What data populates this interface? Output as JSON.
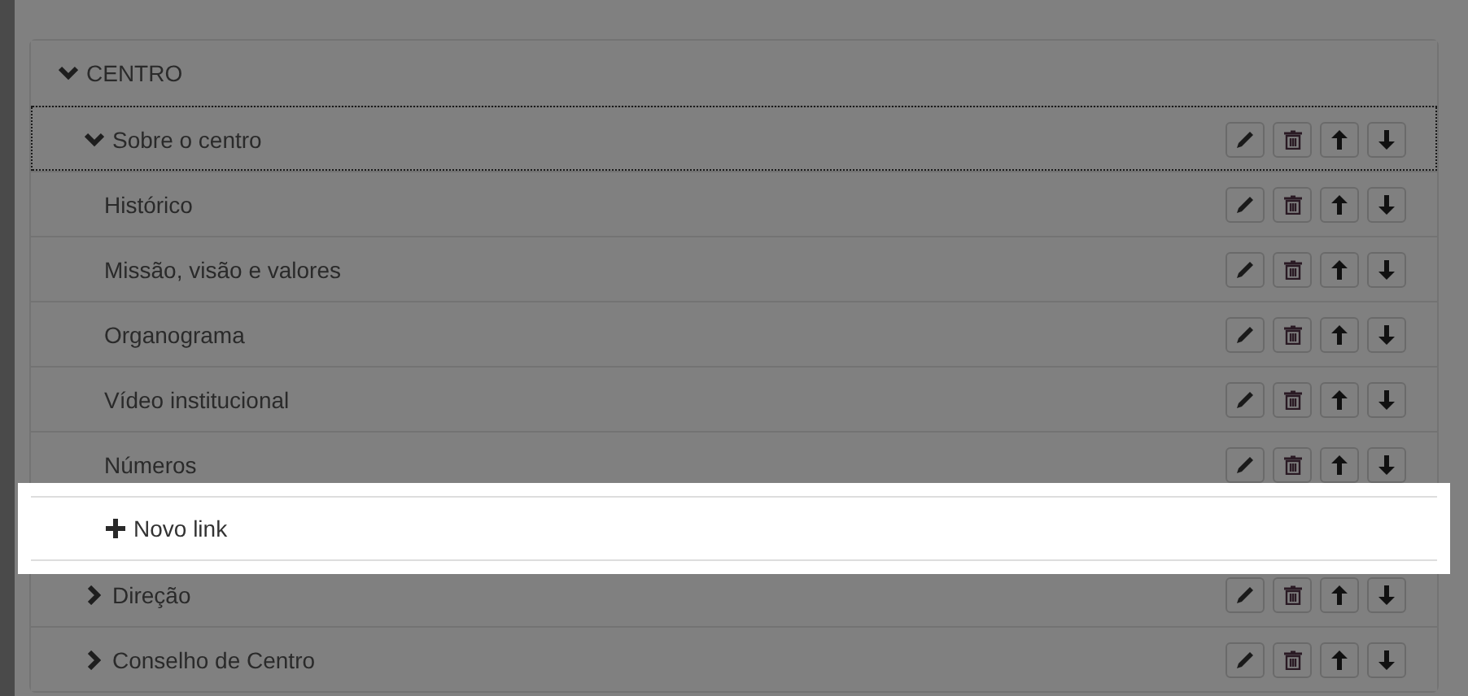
{
  "menu": {
    "label": "CENTRO",
    "expanded": true,
    "items": [
      {
        "label": "Sobre o centro",
        "expanded": true,
        "focused": true,
        "children": [
          {
            "label": "Histórico"
          },
          {
            "label": "Missão, visão e valores"
          },
          {
            "label": "Organograma"
          },
          {
            "label": "Vídeo institucional"
          },
          {
            "label": "Números"
          }
        ],
        "add_link": {
          "label": "Novo link",
          "highlighted": true
        }
      },
      {
        "label": "Direção",
        "expanded": false,
        "focused": false
      },
      {
        "label": "Conselho de Centro",
        "expanded": false,
        "focused": false
      }
    ]
  }
}
